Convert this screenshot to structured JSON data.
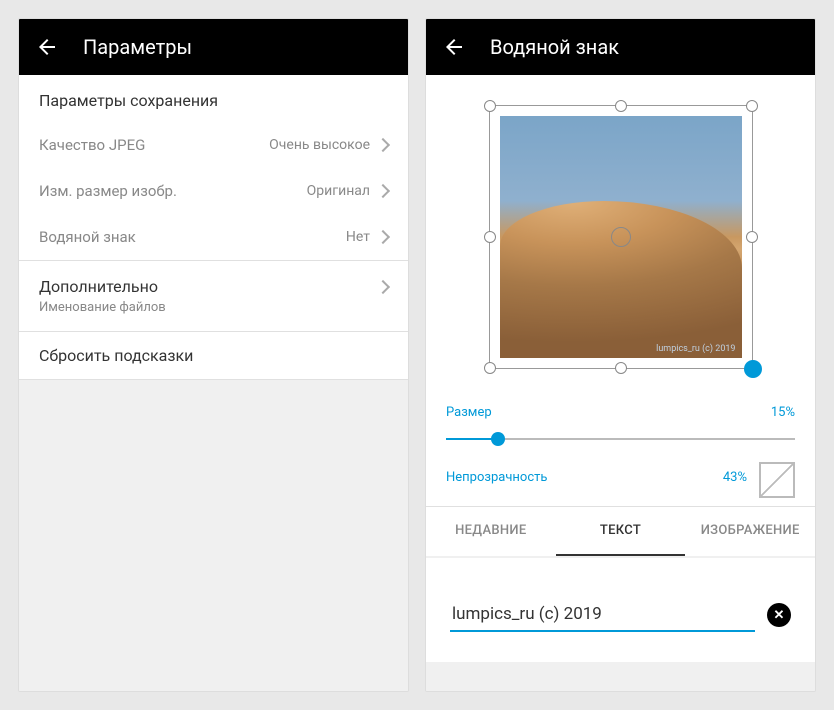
{
  "left": {
    "title": "Параметры",
    "section_header": "Параметры сохранения",
    "rows": [
      {
        "label": "Качество JPEG",
        "value": "Очень высокое"
      },
      {
        "label": "Изм. размер изобр.",
        "value": "Оригинал"
      },
      {
        "label": "Водяной знак",
        "value": "Нет"
      }
    ],
    "more": {
      "label": "Дополнительно",
      "sub": "Именование файлов"
    },
    "reset": "Сбросить подсказки"
  },
  "right": {
    "title": "Водяной знак",
    "watermark_preview": "lumpics_ru (c) 2019",
    "size": {
      "label": "Размер",
      "value": "15%",
      "percent": 15
    },
    "opacity": {
      "label": "Непрозрачность",
      "value": "43%",
      "percent": 43
    },
    "tabs": {
      "recent": "НЕДАВНИЕ",
      "text": "ТЕКСТ",
      "image": "ИЗОБРАЖЕНИЕ"
    },
    "input_value": "lumpics_ru (c) 2019"
  }
}
